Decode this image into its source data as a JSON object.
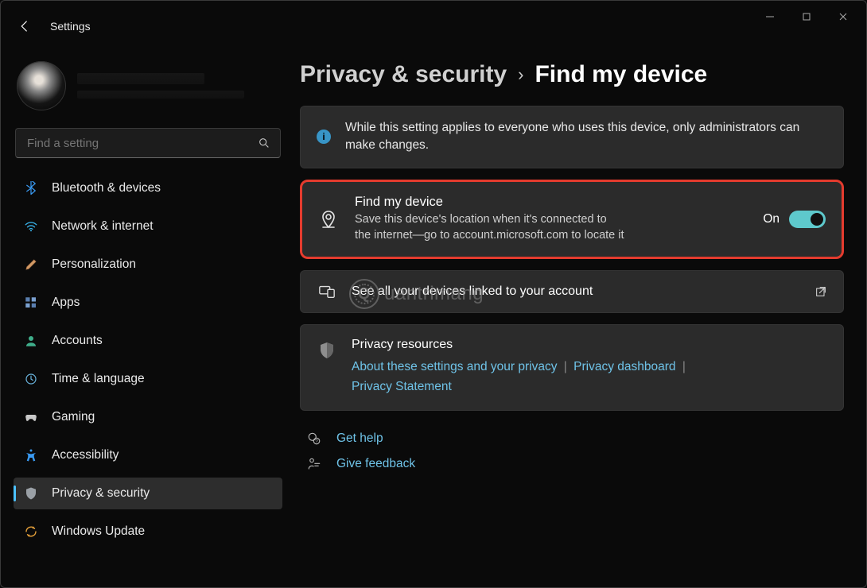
{
  "window": {
    "app_title": "Settings"
  },
  "search": {
    "placeholder": "Find a setting"
  },
  "sidebar": {
    "items": [
      {
        "label": "Bluetooth & devices",
        "icon": "bluetooth"
      },
      {
        "label": "Network & internet",
        "icon": "wifi"
      },
      {
        "label": "Personalization",
        "icon": "brush"
      },
      {
        "label": "Apps",
        "icon": "apps"
      },
      {
        "label": "Accounts",
        "icon": "person"
      },
      {
        "label": "Time & language",
        "icon": "clock"
      },
      {
        "label": "Gaming",
        "icon": "gamepad"
      },
      {
        "label": "Accessibility",
        "icon": "accessibility"
      },
      {
        "label": "Privacy & security",
        "icon": "shield",
        "active": true
      },
      {
        "label": "Windows Update",
        "icon": "update"
      }
    ]
  },
  "breadcrumb": {
    "parent": "Privacy & security",
    "current": "Find my device"
  },
  "info_banner": "While this setting applies to everyone who uses this device, only administrators can make changes.",
  "find_my_device": {
    "title": "Find my device",
    "subtitle": "Save this device's location when it's connected to the internet—go to account.microsoft.com to locate it",
    "toggle_label": "On",
    "toggle_state": true,
    "highlighted": true
  },
  "devices_link": "See all your devices linked to your account",
  "resources": {
    "title": "Privacy resources",
    "links": [
      "About these settings and your privacy",
      "Privacy dashboard",
      "Privacy Statement"
    ]
  },
  "aux": {
    "help": "Get help",
    "feedback": "Give feedback"
  },
  "watermark": "uantrimang"
}
